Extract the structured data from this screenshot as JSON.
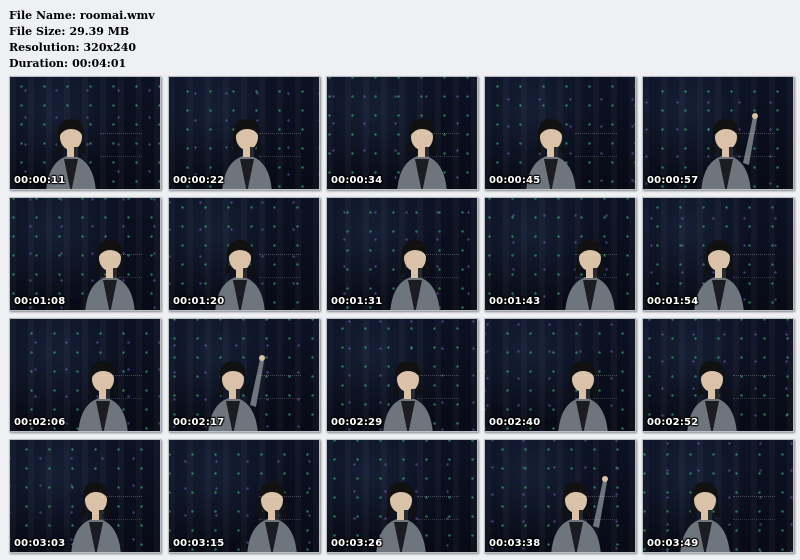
{
  "file_info": {
    "name_label": "File Name:",
    "name_value": "roomai.wmv",
    "size_label": "File Size:",
    "size_value": "29.39 MB",
    "resolution_label": "Resolution:",
    "resolution_value": "320x240",
    "duration_label": "Duration:",
    "duration_value": "00:04:01"
  },
  "colors": {
    "background": "#eef0f3",
    "thumb_bg": "#0b0e1c",
    "timestamp": "#ffffff"
  },
  "thumbnails": [
    "00:00:11",
    "00:00:22",
    "00:00:34",
    "00:00:45",
    "00:00:57",
    "00:01:08",
    "00:01:20",
    "00:01:31",
    "00:01:43",
    "00:01:54",
    "00:02:06",
    "00:02:17",
    "00:02:29",
    "00:02:40",
    "00:02:52",
    "00:03:03",
    "00:03:15",
    "00:03:26",
    "00:03:38",
    "00:03:49"
  ]
}
